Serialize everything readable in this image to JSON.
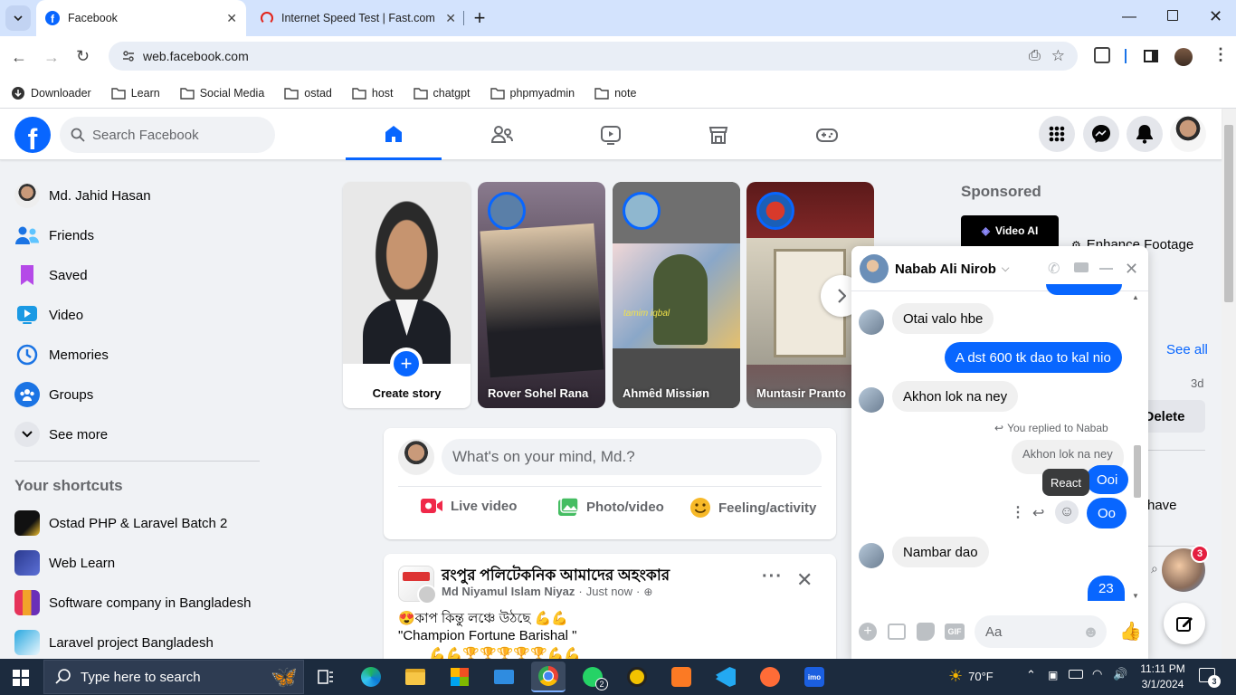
{
  "browser": {
    "tabs": [
      {
        "title": "Facebook",
        "active": true
      },
      {
        "title": "Internet Speed Test | Fast.com",
        "active": false
      }
    ],
    "url": "web.facebook.com",
    "bookmarks": [
      "Downloader",
      "Learn",
      "Social Media",
      "ostad",
      "host",
      "chatgpt",
      "phpmyadmin",
      "note"
    ]
  },
  "header": {
    "search_placeholder": "Search Facebook"
  },
  "sidebar": {
    "profile_name": "Md. Jahid Hasan",
    "items": [
      {
        "label": "Friends",
        "icon": "friends-icon"
      },
      {
        "label": "Saved",
        "icon": "bookmark-icon"
      },
      {
        "label": "Video",
        "icon": "video-icon"
      },
      {
        "label": "Memories",
        "icon": "clock-icon"
      },
      {
        "label": "Groups",
        "icon": "groups-icon"
      },
      {
        "label": "See more",
        "icon": "chevron-down-icon"
      }
    ],
    "shortcuts_title": "Your shortcuts",
    "shortcuts": [
      "Ostad PHP & Laravel Batch 2",
      "Web Learn",
      "Software company in Bangladesh",
      "Laravel project Bangladesh"
    ]
  },
  "stories": {
    "create_label": "Create story",
    "items": [
      "Rover Sohel Rana",
      "Ahmêd Missiøn",
      "Muntasir Pranto"
    ],
    "overlay_text": "tamim iqbal"
  },
  "composer": {
    "placeholder": "What's on your mind, Md.?",
    "actions": [
      "Live video",
      "Photo/video",
      "Feeling/activity"
    ]
  },
  "post": {
    "page_name": "রংপুর পলিটেকনিক আমাদের অহংকার",
    "author": "Md Niyamul Islam Niyaz",
    "time": "Just now",
    "text_line1": "😍কাপ কিন্তু লঞ্চে উঠছে 💪💪",
    "text_line2": "\"Champion  Fortune Barishal \"",
    "text_line3": "💪💪🏆🏆🏆🏆🏆💪💪"
  },
  "right": {
    "sponsored_title": "Sponsored",
    "ad_badge": "Video AI",
    "ad_text": "Enhance Footage",
    "see_all": "See all",
    "age": "3d",
    "delete_label": "Delete",
    "partial_text": "have",
    "chat_heads_badge": "3"
  },
  "chat": {
    "name": "Nabab Ali Nirob",
    "reply_note": "You replied to Nabab",
    "quoted": "Akhon lok na ney",
    "tooltip": "React",
    "input_placeholder": "Aa",
    "gif_label": "GIF",
    "messages": [
      {
        "from": "them",
        "text": "Otai valo hbe"
      },
      {
        "from": "me",
        "text": "A dst 600 tk dao to kal nio"
      },
      {
        "from": "them",
        "text": "Akhon lok na ney"
      },
      {
        "from": "me",
        "text": "Ooi"
      },
      {
        "from": "me",
        "text": "Oo"
      },
      {
        "from": "them",
        "text": "Nambar dao"
      },
      {
        "from": "me",
        "text": "23"
      }
    ]
  },
  "taskbar": {
    "search_placeholder": "Type here to search",
    "whatsapp_badge": "2",
    "weather": "70°F",
    "time": "11:11 PM",
    "date": "3/1/2024",
    "notification_count": "3",
    "imo_label": "imo"
  },
  "colors": {
    "facebook_blue": "#0866ff",
    "chrome_tabstrip": "#d3e3fd",
    "taskbar": "#1c2b3e"
  }
}
